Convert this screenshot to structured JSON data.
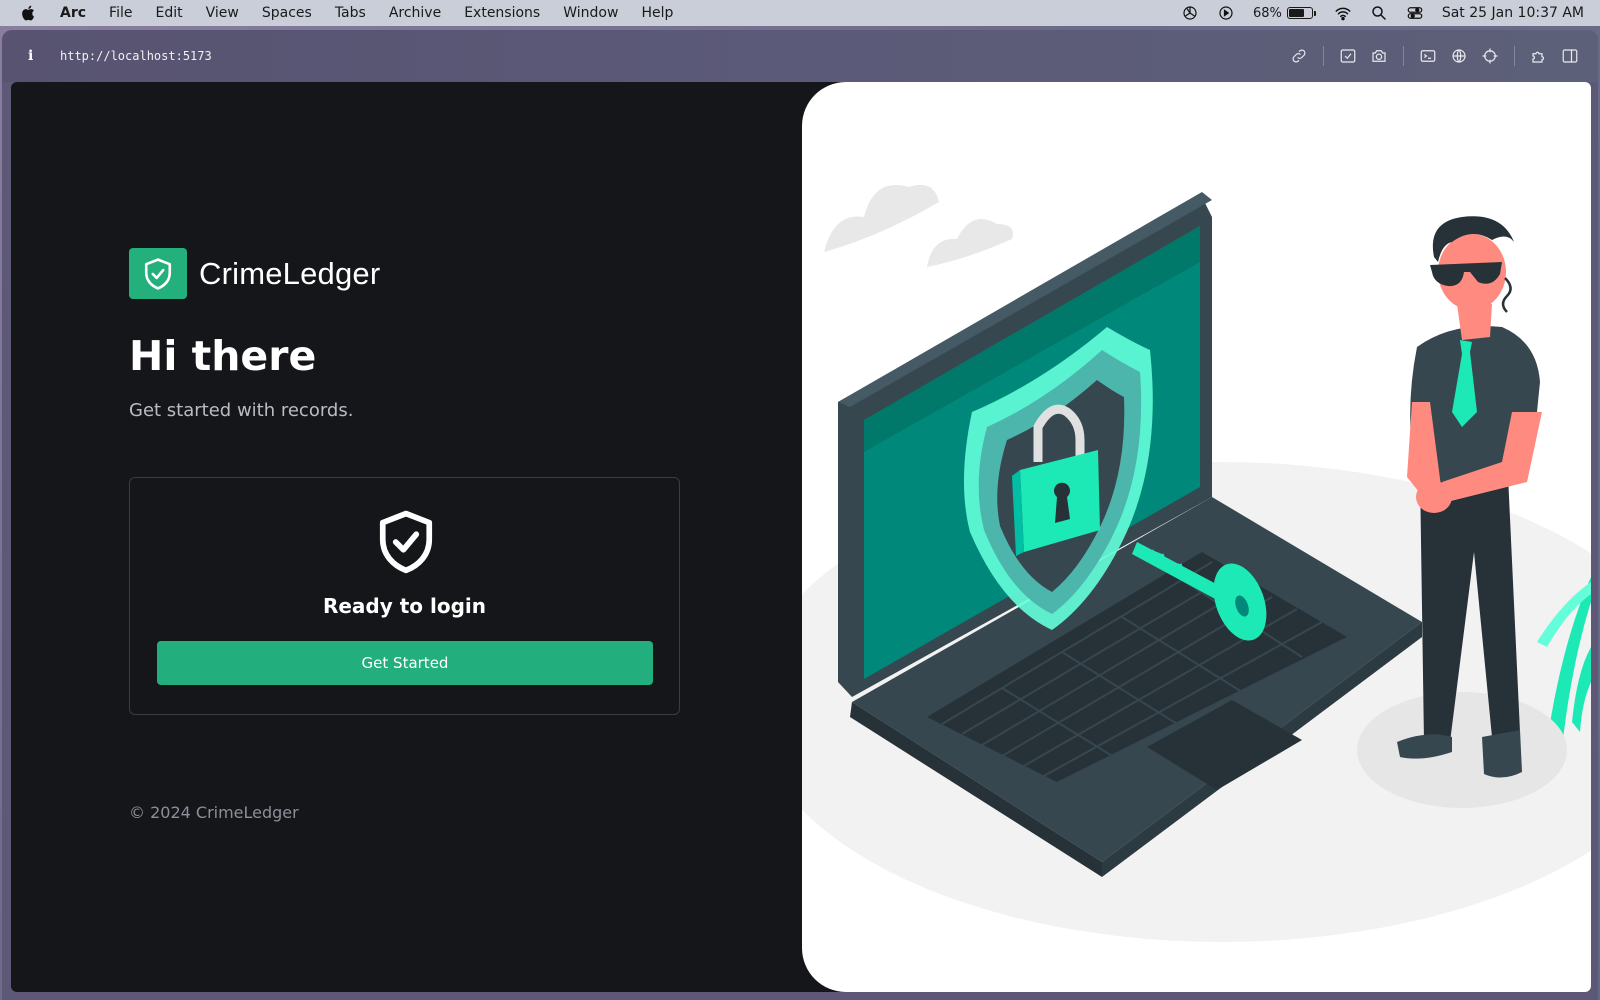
{
  "menubar": {
    "app": "Arc",
    "items": [
      "File",
      "Edit",
      "View",
      "Spaces",
      "Tabs",
      "Archive",
      "Extensions",
      "Window",
      "Help"
    ],
    "battery_percent": "68%",
    "battery_level": 0.68,
    "datetime": "Sat 25 Jan  10:37 AM"
  },
  "toolbar": {
    "info": "i",
    "url": "http://localhost:5173"
  },
  "page": {
    "brand": "CrimeLedger",
    "greeting": "Hi there",
    "subtitle": "Get started with records.",
    "card_title": "Ready to login",
    "cta_label": "Get Started",
    "footer": "© 2024 CrimeLedger"
  },
  "colors": {
    "accent": "#23b07d",
    "background": "#15161a",
    "illustration_teal": "#13d9b5",
    "illustration_dark": "#37474f"
  }
}
